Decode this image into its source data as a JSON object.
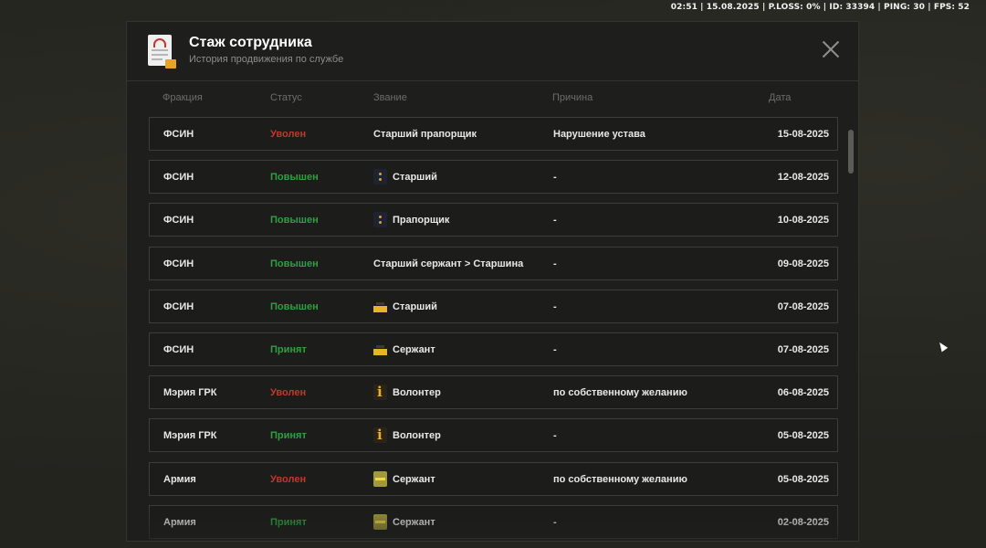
{
  "hud": {
    "text": "02:51 | 15.08.2025 | P.LOSS: 0% | ID: 33394 | PING: 30 | FPS: 52"
  },
  "modal": {
    "title": "Стаж сотрудника",
    "subtitle": "История продвижения по службе",
    "icon": "document-stamp-icon"
  },
  "columns": {
    "faction": "Фракция",
    "status": "Статус",
    "rank": "Звание",
    "reason": "Причина",
    "date": "Дата"
  },
  "status_colors": {
    "Уволен": "#c0392b",
    "Повышен": "#2ea043",
    "Принят": "#2ea043"
  },
  "rows": [
    {
      "faction": "ФСИН",
      "status": "Уволен",
      "rank": "Старший прапорщик",
      "rank_icon": "",
      "reason": "Нарушение устава",
      "date": "15-08-2025"
    },
    {
      "faction": "ФСИН",
      "status": "Повышен",
      "rank": "Старший",
      "rank_icon": "dots",
      "reason": "-",
      "date": "12-08-2025"
    },
    {
      "faction": "ФСИН",
      "status": "Повышен",
      "rank": "Прапорщик",
      "rank_icon": "dots",
      "reason": "-",
      "date": "10-08-2025"
    },
    {
      "faction": "ФСИН",
      "status": "Повышен",
      "rank": "Старший сержант > Старшина",
      "rank_icon": "",
      "reason": "-",
      "date": "09-08-2025"
    },
    {
      "faction": "ФСИН",
      "status": "Повышен",
      "rank": "Старший",
      "rank_icon": "bar",
      "reason": "-",
      "date": "07-08-2025"
    },
    {
      "faction": "ФСИН",
      "status": "Принят",
      "rank": "Сержант",
      "rank_icon": "bar",
      "reason": "-",
      "date": "07-08-2025"
    },
    {
      "faction": "Мэрия ГРК",
      "status": "Уволен",
      "rank": "Волонтер",
      "rank_icon": "i",
      "reason": "по собственному желанию",
      "date": "06-08-2025"
    },
    {
      "faction": "Мэрия ГРК",
      "status": "Принят",
      "rank": "Волонтер",
      "rank_icon": "i",
      "reason": "-",
      "date": "05-08-2025"
    },
    {
      "faction": "Армия",
      "status": "Уволен",
      "rank": "Сержант",
      "rank_icon": "army",
      "reason": "по собственному желанию",
      "date": "05-08-2025"
    },
    {
      "faction": "Армия",
      "status": "Принят",
      "rank": "Сержант",
      "rank_icon": "army",
      "reason": "-",
      "date": "02-08-2025"
    }
  ]
}
